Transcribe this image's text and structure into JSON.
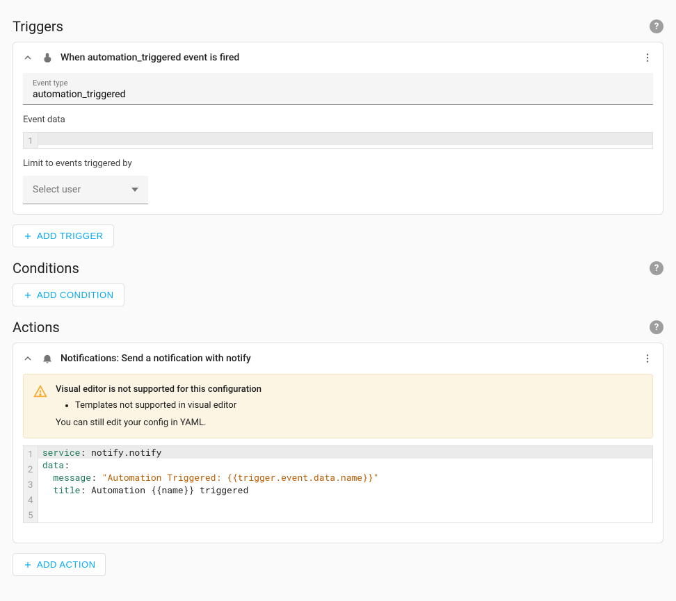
{
  "sections": {
    "triggers_title": "Triggers",
    "conditions_title": "Conditions",
    "actions_title": "Actions"
  },
  "buttons": {
    "add_trigger": "ADD TRIGGER",
    "add_condition": "ADD CONDITION",
    "add_action": "ADD ACTION"
  },
  "trigger": {
    "summary": "When automation_triggered event is fired",
    "event_type_label": "Event type",
    "event_type_value": "automation_triggered",
    "event_data_label": "Event data",
    "event_data_lines": [
      "1"
    ],
    "limit_label": "Limit to events triggered by",
    "select_user_placeholder": "Select user"
  },
  "action": {
    "summary": "Notifications: Send a notification with notify",
    "alert_title": "Visual editor is not supported for this configuration",
    "alert_bullet1": "Templates not supported in visual editor",
    "alert_note": "You can still edit your config in YAML.",
    "yaml_lines": [
      "1",
      "2",
      "3",
      "4",
      "5"
    ],
    "yaml": {
      "l1_k": "service",
      "l1_v": ": notify.notify",
      "l2_k": "data",
      "l2_v": ":",
      "l3_k": "  message",
      "l3_c": ": ",
      "l3_s": "\"Automation Triggered: {{trigger.event.data.name}}\"",
      "l4_k": "  title",
      "l4_v": ": Automation {{name}} triggered"
    }
  }
}
